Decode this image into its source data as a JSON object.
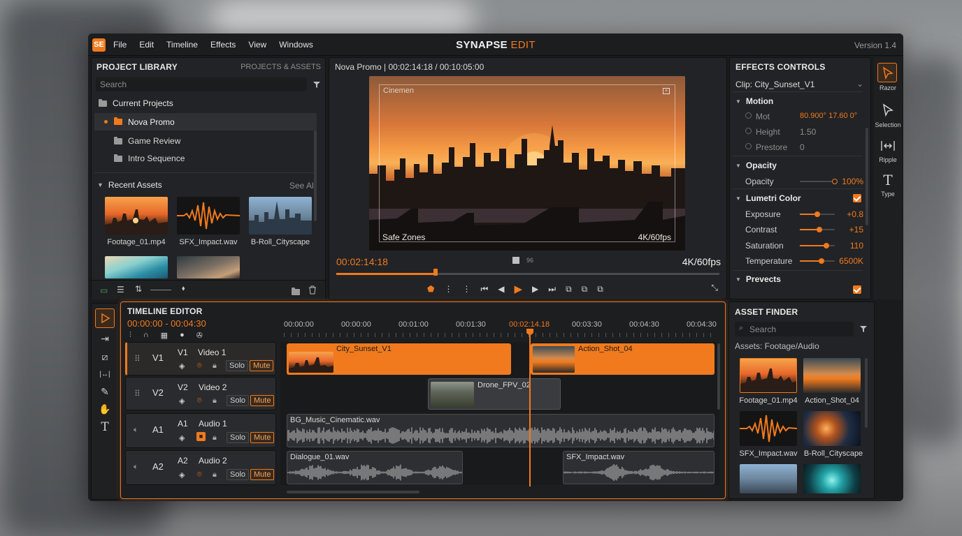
{
  "app": {
    "logo": "SE",
    "title_main": "SYNAPSE",
    "title_accent": "EDIT",
    "version": "Version  1.4",
    "menu": [
      "File",
      "Edit",
      "Timeline",
      "Effects",
      "View",
      "Windows"
    ],
    "accent": "#f07a1d"
  },
  "library": {
    "title": "PROJECT LIBRARY",
    "tab": "PROJECTS & ASSETS",
    "search_placeholder": "Search",
    "current_projects": "Current Projects",
    "projects": [
      "Nova Promo",
      "Game Review",
      "Intro Sequence"
    ],
    "recent_assets": "Recent Assets",
    "see_all": "See All",
    "assets": [
      "Footage_01.mp4",
      "SFX_Impact.wav",
      "B-Roll_Cityscape"
    ]
  },
  "viewer": {
    "header": "Nova Promo | 00:02:14:18 / 00:10:05:00",
    "overlay_top": "Cinemen",
    "safe_zones": "Safe Zones",
    "format_overlay": "4K/60fps",
    "current_time": "00:02:14:18",
    "marker_label": "96",
    "format": "4K/60fps",
    "progress": 0.26
  },
  "effects": {
    "title": "EFFECTS CONTROLS",
    "clip": "Clip: City_Sunset_V1",
    "motion": {
      "label": "Motion",
      "mot_label": "Mot",
      "mot_value": "80.900°  17.60 0°",
      "height_label": "Height",
      "height_value": "1.50",
      "prestore_label": "Prestore",
      "prestore_value": "0"
    },
    "opacity": {
      "label": "Opacity",
      "row_label": "Opacity",
      "value": "100%",
      "level": 1.0
    },
    "lumetri": {
      "label": "Lumetri Color",
      "rows": [
        {
          "label": "Exposure",
          "value": "+0.8",
          "level": 0.5
        },
        {
          "label": "Contrast",
          "value": "+15",
          "level": 0.55
        },
        {
          "label": "Saturation",
          "value": "110",
          "level": 0.75
        },
        {
          "label": "Temperature",
          "value": "6500K",
          "level": 0.62
        }
      ]
    },
    "prevects": "Prevects"
  },
  "tools": {
    "items": [
      "Razor",
      "Selection",
      "Ripple",
      "Type"
    ]
  },
  "timeline": {
    "title": "TIMELINE EDITOR",
    "range": "00:00:00 - 00:04:30",
    "ruler": [
      "00:00:00",
      "00:00:00",
      "00:01:00",
      "00:01:30",
      "00:02:14.18",
      "00:03:30",
      "00:04:30",
      "00:04:30"
    ],
    "tracks": [
      {
        "id": "V1",
        "name": "Video 1",
        "solo": "Solo",
        "mute": "Mute"
      },
      {
        "id": "V2",
        "name": "Video 2",
        "solo": "Solo",
        "mute": "Mute"
      },
      {
        "id": "A1",
        "name": "Audio 1",
        "solo": "Solo",
        "mute": "Mute"
      },
      {
        "id": "A2",
        "name": "Audio 2",
        "solo": "Solo",
        "mute": "Mute"
      }
    ],
    "clips": {
      "city": "City_Sunset_V1",
      "action": "Action_Shot_04",
      "drone": "Drone_FPV_02",
      "music": "BG_Music_Cinematic.wav",
      "dialogue": "Dialogue_01.wav",
      "sfx": "SFX_Impact.wav"
    }
  },
  "finder": {
    "title": "ASSET FINDER",
    "search_placeholder": "Search",
    "filter_label": "Assets: Footage/Audio",
    "assets": [
      "Footage_01.mp4",
      "Action_Shot_04",
      "SFX_Impact.wav",
      "B-Roll_Cityscape"
    ]
  }
}
